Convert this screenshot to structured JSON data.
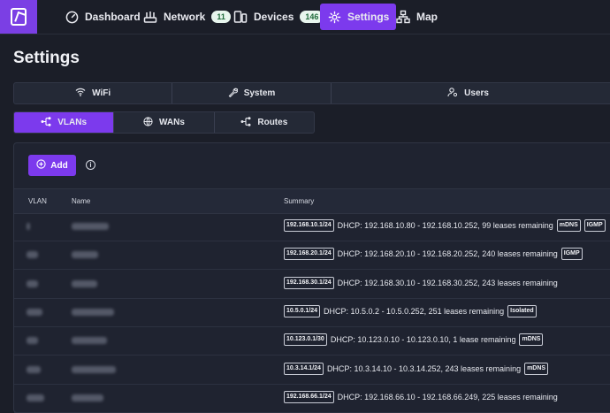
{
  "nav": {
    "items": [
      {
        "label": "Dashboard"
      },
      {
        "label": "Network",
        "badge": "11"
      },
      {
        "label": "Devices",
        "badge": "146"
      },
      {
        "label": "Settings",
        "active": true
      },
      {
        "label": "Map"
      }
    ]
  },
  "page": {
    "title": "Settings"
  },
  "tabs_primary": [
    {
      "label": "WiFi"
    },
    {
      "label": "System"
    },
    {
      "label": "Users"
    }
  ],
  "tabs_secondary": [
    {
      "label": "VLANs",
      "active": true
    },
    {
      "label": "WANs"
    },
    {
      "label": "Routes"
    }
  ],
  "toolbar": {
    "add_label": "Add"
  },
  "table": {
    "headers": [
      "VLAN",
      "Name",
      "Summary"
    ],
    "rows": [
      {
        "cidr": "192.168.10.1/24",
        "summary": "DHCP: 192.168.10.80 - 192.168.10.252, 99 leases remaining",
        "tags": [
          "mDNS",
          "IGMP"
        ]
      },
      {
        "cidr": "192.168.20.1/24",
        "summary": "DHCP: 192.168.20.10 - 192.168.20.252, 240 leases remaining",
        "tags": [
          "IGMP"
        ]
      },
      {
        "cidr": "192.168.30.1/24",
        "summary": "DHCP: 192.168.30.10 - 192.168.30.252, 243 leases remaining",
        "tags": []
      },
      {
        "cidr": "10.5.0.1/24",
        "summary": "DHCP: 10.5.0.2 - 10.5.0.252, 251 leases remaining",
        "tags": [
          "Isolated"
        ]
      },
      {
        "cidr": "10.123.0.1/30",
        "summary": "DHCP: 10.123.0.10 - 10.123.0.10, 1 lease remaining",
        "tags": [
          "mDNS"
        ]
      },
      {
        "cidr": "10.3.14.1/24",
        "summary": "DHCP: 10.3.14.10 - 10.3.14.252, 243 leases remaining",
        "tags": [
          "mDNS"
        ]
      },
      {
        "cidr": "192.168.66.1/24",
        "summary": "DHCP: 192.168.66.10 - 192.168.66.249, 225 leases remaining",
        "tags": []
      }
    ]
  },
  "colors": {
    "accent": "#7c3aed",
    "background": "#1b1e28",
    "badge_bg": "#e8f6ee",
    "badge_text": "#1f6b3b"
  }
}
